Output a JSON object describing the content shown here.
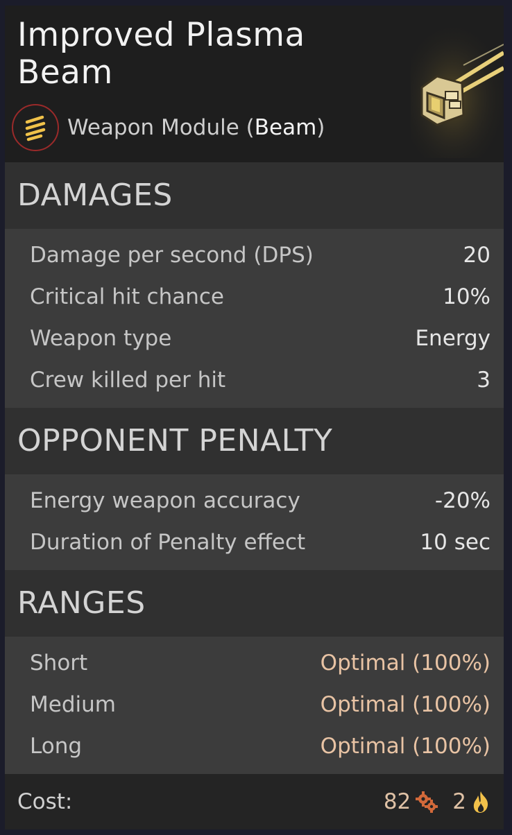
{
  "header": {
    "title": "Improved Plasma Beam",
    "subtitle_prefix": "Weapon Module (",
    "subtitle_type": "Beam",
    "subtitle_suffix": ")"
  },
  "sections": {
    "damages": {
      "title": "DAMAGES",
      "rows": [
        {
          "label": "Damage per second (DPS)",
          "value": "20"
        },
        {
          "label": "Critical hit chance",
          "value": "10%"
        },
        {
          "label": "Weapon type",
          "value": "Energy"
        },
        {
          "label": "Crew killed per hit",
          "value": "3"
        }
      ]
    },
    "penalty": {
      "title": "OPPONENT PENALTY",
      "rows": [
        {
          "label": "Energy weapon accuracy",
          "value": "-20%"
        },
        {
          "label": "Duration of Penalty effect",
          "value": "10 sec"
        }
      ]
    },
    "ranges": {
      "title": "RANGES",
      "rows": [
        {
          "label": "Short",
          "value": "Optimal (100%)"
        },
        {
          "label": "Medium",
          "value": "Optimal (100%)"
        },
        {
          "label": "Long",
          "value": "Optimal (100%)"
        }
      ]
    }
  },
  "cost": {
    "label": "Cost:",
    "parts_amount": "82",
    "parts_icon": "gears-icon",
    "energy_amount": "2",
    "energy_icon": "flame-icon"
  },
  "colors": {
    "accent_gold": "#f0c24a",
    "icon_ring": "#9a2a2a",
    "optimal": "#e8c3a4"
  }
}
